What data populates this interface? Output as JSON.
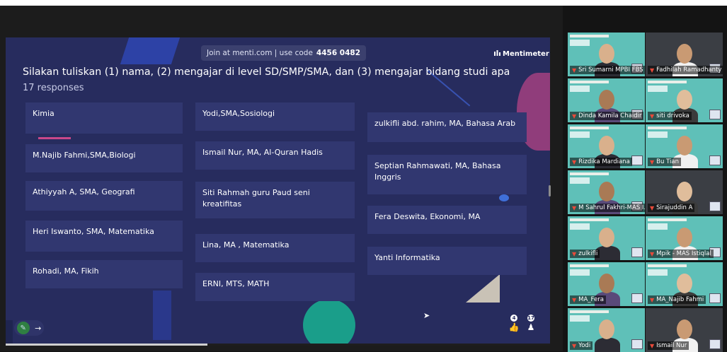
{
  "slide": {
    "join_text": "Join at menti.com | use code",
    "join_code": "4456 0482",
    "brand": "Mentimeter",
    "question": "Silakan tuliskan (1) nama, (2) mengajar di level SD/SMP/SMA, dan (3) mengajar bidang studi apa",
    "response_count": "17 responses",
    "responses": [
      "Kimia",
      "M.Najib Fahmi,SMA,Biologi",
      "Athiyyah A, SMA, Geografi",
      "Heri Iswanto, SMA, Matematika",
      "Rohadi, MA, Fikih",
      "Yodi,SMA,Sosiologi",
      "Ismail Nur, MA, Al-Quran Hadis",
      "Siti Rahmah guru Paud seni kreatifitas",
      "Lina, MA , Matematika",
      "ERNI, MTS, MATH",
      "zulkifli abd. rahim, MA, Bahasa Arab",
      "Septian Rahmawati, MA, Bahasa Inggris",
      "Fera Deswita, Ekonomi, MA",
      "Yanti Informatika"
    ],
    "reactions": {
      "likes": "4",
      "people": "17"
    },
    "progress": 0.37,
    "icons": {
      "brand": "mentimeter-logo-icon",
      "pen": "pen-icon",
      "next": "arrow-right-icon",
      "like": "thumbs-up-icon",
      "people": "person-icon",
      "cursor": "mouse-cursor-icon",
      "mic": "muted-mic-icon"
    }
  },
  "participants": [
    {
      "name": "Sri Sumarni MPBI FBS ...",
      "bg": "teal"
    },
    {
      "name": "Fadhilah Ramadhanty",
      "bg": "cam"
    },
    {
      "name": "Dinda Kamila Chaidir",
      "bg": "teal"
    },
    {
      "name": "siti drivoka",
      "bg": "teal"
    },
    {
      "name": "Rizdika Mardiana",
      "bg": "teal"
    },
    {
      "name": "Bu Tian",
      "bg": "teal"
    },
    {
      "name": "M Sahrul Fakhri-MAS I...",
      "bg": "teal"
    },
    {
      "name": "Sirajuddin A",
      "bg": "cam"
    },
    {
      "name": "zulkifli",
      "bg": "teal"
    },
    {
      "name": "Mpik - MAS Istiqlal",
      "bg": "teal"
    },
    {
      "name": "MA_Fera",
      "bg": "teal"
    },
    {
      "name": "MA_Najib Fahmi",
      "bg": "teal"
    },
    {
      "name": "Yodi",
      "bg": "teal"
    },
    {
      "name": "Ismail Nur",
      "bg": "cam"
    }
  ],
  "colors": {
    "slide_bg": "#272c5e",
    "card_bg": "#313770",
    "accent_pink": "#c9478a",
    "accent_teal": "#1a9e8a",
    "active_speaker": "#9fd06b",
    "muted_mic": "#e84a3a"
  }
}
